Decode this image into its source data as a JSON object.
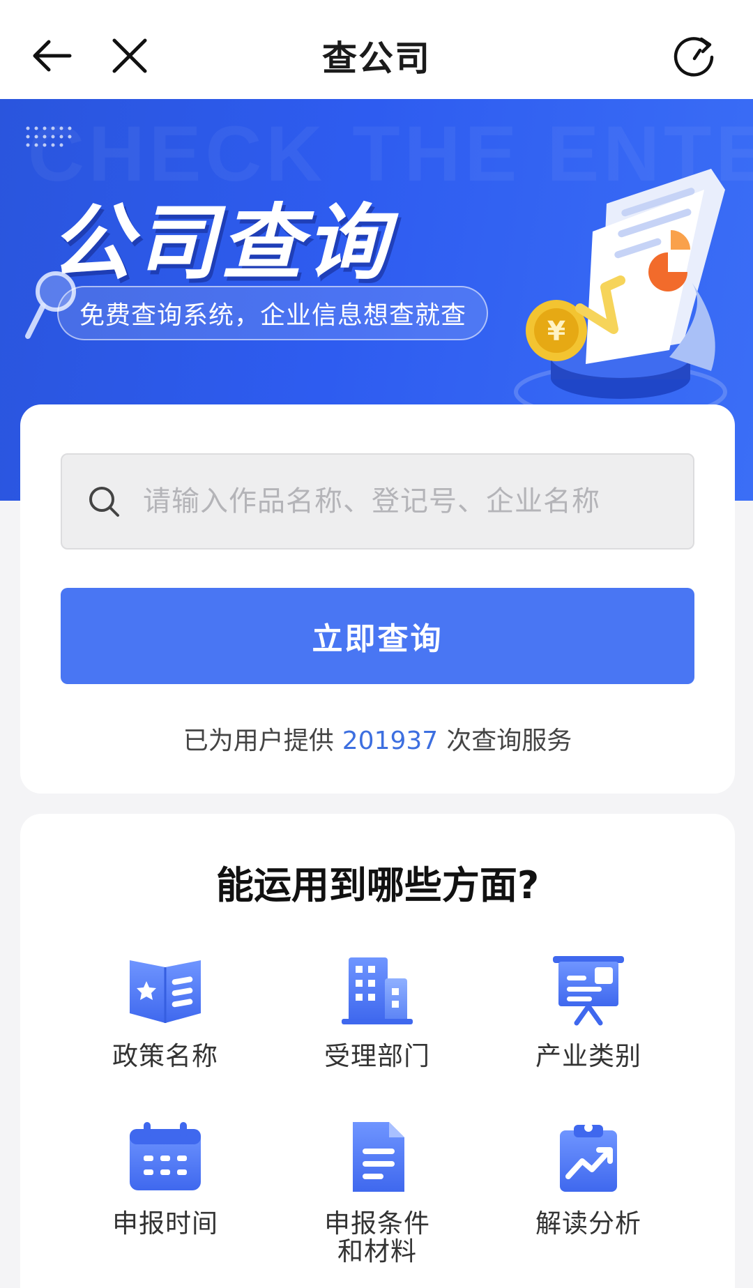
{
  "header": {
    "title": "查公司",
    "back_icon": "arrow-left-icon",
    "close_icon": "close-icon",
    "refresh_icon": "refresh-icon"
  },
  "banner": {
    "watermark": "CHECK THE ENTE",
    "title": "公司查询",
    "subtitle": "免费查询系统，企业信息想查就查"
  },
  "search": {
    "placeholder": "请输入作品名称、登记号、企业名称",
    "value": "",
    "submit_label": "立即查询",
    "stats_prefix": "已为用户提供",
    "stats_count": "201937",
    "stats_suffix": "次查询服务"
  },
  "uses": {
    "title": "能运用到哪些方面?",
    "items": [
      {
        "label": "政策名称",
        "icon": "policy-book-icon"
      },
      {
        "label": "受理部门",
        "icon": "building-icon"
      },
      {
        "label": "产业类别",
        "icon": "presentation-board-icon"
      },
      {
        "label": "申报时间",
        "icon": "calendar-icon"
      },
      {
        "label": "申报条件\n和材料",
        "icon": "document-icon"
      },
      {
        "label": "解读分析",
        "icon": "clipboard-chart-icon"
      }
    ]
  },
  "colors": {
    "accent": "#4976f3",
    "banner_blue": "#2e5cf0",
    "count_blue": "#3d6fe0"
  }
}
